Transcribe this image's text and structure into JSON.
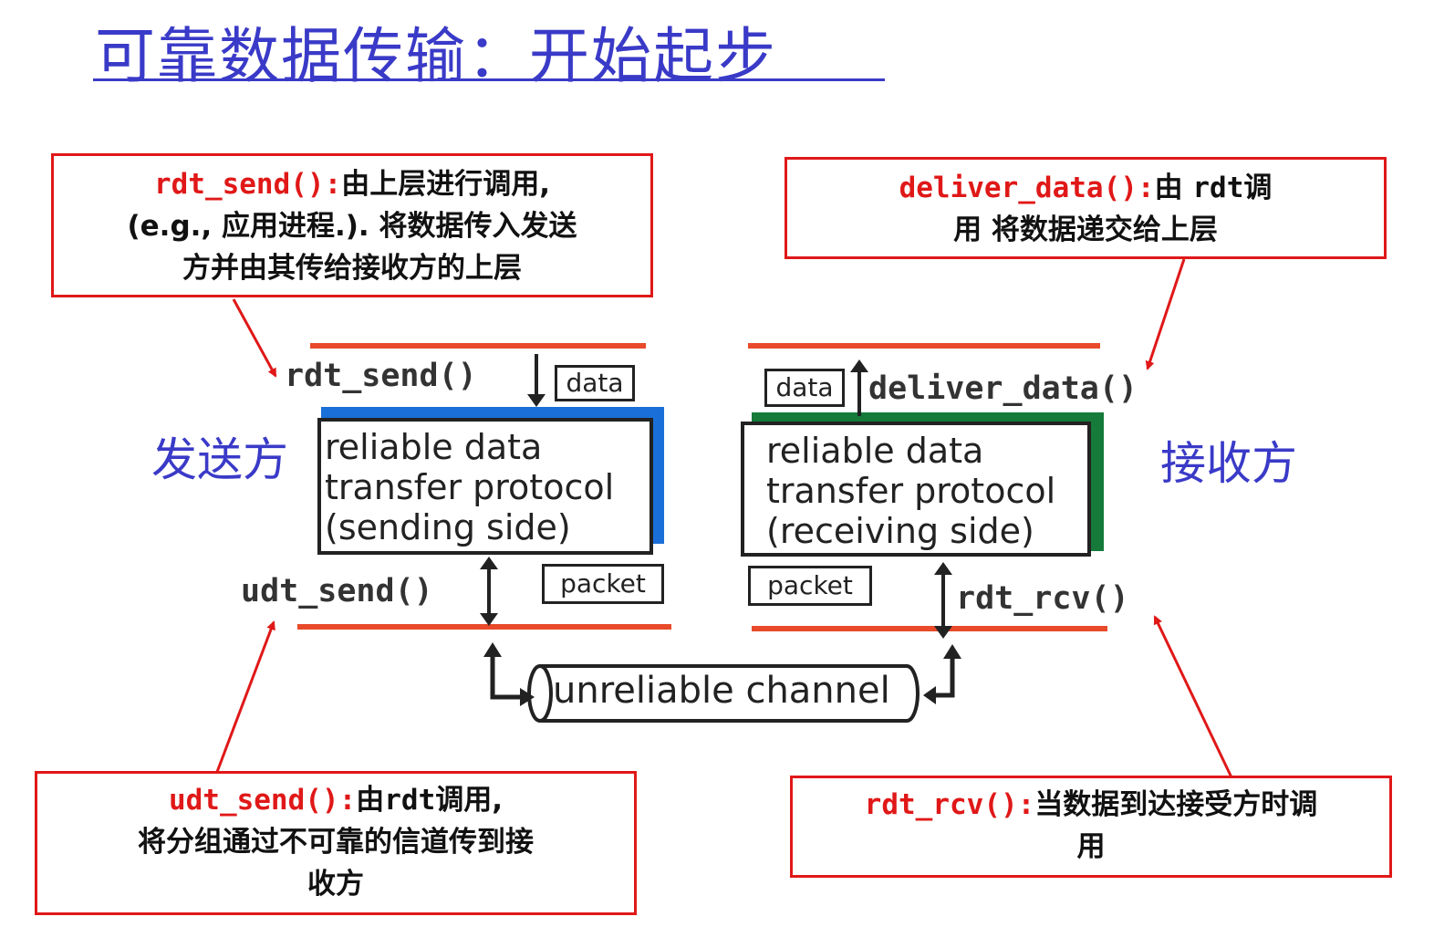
{
  "title": "可靠数据传输：开始起步",
  "callouts": {
    "rdt_send": {
      "fn": "rdt_send():",
      "line1": "由上层进行调用,",
      "line2": "(e.g., 应用进程.). 将数据传入发送",
      "line3": "方并由其传给接收方的上层"
    },
    "deliver_data": {
      "fn": "deliver_data():",
      "line1a": "由 ",
      "line1b": "rdt",
      "line1c": "调",
      "line2": "用 将数据递交给上层"
    },
    "udt_send": {
      "fn": "udt_send():",
      "line1a": "由",
      "line1b": "rdt",
      "line1c": "调用,",
      "line2": "将分组通过不可靠的信道传到接",
      "line3": "收方"
    },
    "rdt_rcv": {
      "fn": "rdt_rcv():",
      "line1": "当数据到达接受方时调",
      "line2": "用"
    }
  },
  "sender": {
    "label": "发送方",
    "top_fn": "rdt_send()",
    "bottom_fn": "udt_send()",
    "data_tag": "data",
    "packet_tag": "packet",
    "protocol_lines": [
      "reliable data",
      "transfer protocol",
      "(sending side)"
    ],
    "accent": "#1a6fd8"
  },
  "receiver": {
    "label": "接收方",
    "top_fn": "deliver_data()",
    "bottom_fn": "rdt_rcv()",
    "data_tag": "data",
    "packet_tag": "packet",
    "protocol_lines": [
      "reliable data",
      "transfer protocol",
      "(receiving side)"
    ],
    "accent": "#157a3a"
  },
  "channel": {
    "label": "unreliable channel"
  }
}
